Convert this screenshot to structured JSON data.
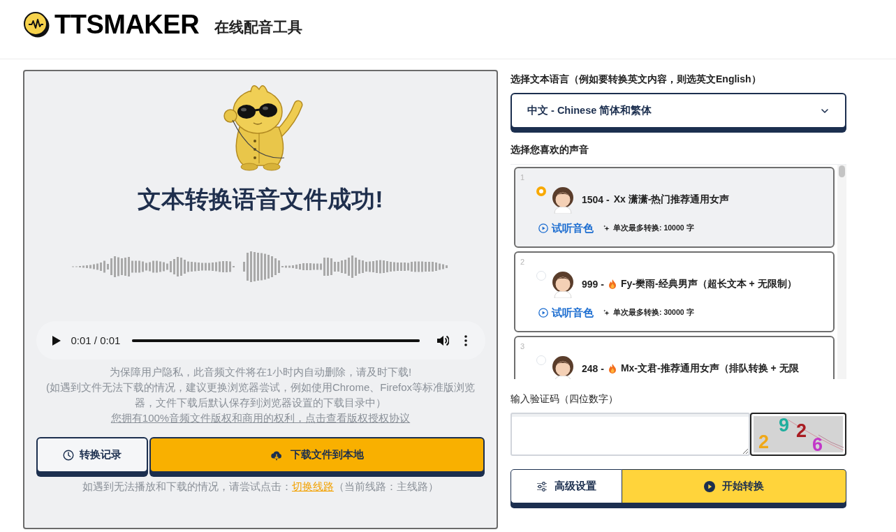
{
  "header": {
    "logo_text": "TTSMAKER",
    "tagline": "在线配音工具"
  },
  "result": {
    "title": "文本转换语音文件成功!",
    "player": {
      "time": "0:01 / 0:01",
      "level": 1
    },
    "notice_lines": [
      "为保障用户隐私，此音频文件将在1小时内自动删除，请及时下载!",
      "(如遇到文件无法下载的情况，建议更换浏览器尝试，例如使用Chrome、Firefox等标准版浏览器，文件下载后默认保存到浏览器设置的下载目录中）"
    ],
    "license_link": "您拥有100%音频文件版权和商用的权利，点击查看版权授权协议",
    "buttons": [
      {
        "kind": "history",
        "label": "转换记录"
      },
      {
        "kind": "download",
        "label": "下载文件到本地"
      }
    ],
    "route_note": {
      "text": "如遇到无法播放和下载的情况，请尝试点击：",
      "link": "切换线路",
      "suffix": "（当前线路：主线路）"
    }
  },
  "language": {
    "label": "选择文本语言（例如要转换英文内容，则选英文English）",
    "value": "中文 - Chinese 简体和繁体"
  },
  "voices": {
    "label": "选择您喜欢的声音",
    "items": [
      {
        "index": "1",
        "selected": true,
        "code": "1504 -",
        "hot": false,
        "name": "Xx 潇潇-热门推荐通用女声",
        "preview": "试听音色",
        "limit": "单次最多转换: 10000 字"
      },
      {
        "index": "2",
        "selected": false,
        "code": "999 -",
        "hot": true,
        "name": "Fy-樊雨-经典男声（超长文本 + 无限制）",
        "preview": "试听音色",
        "limit": "单次最多转换: 30000 字"
      },
      {
        "index": "3",
        "selected": false,
        "code": "248 -",
        "hot": true,
        "name": "Mx-文君-推荐通用女声（排队转换 + 无限"
      }
    ]
  },
  "captcha": {
    "label": "输入验证码（四位数字）",
    "chars": [
      {
        "text": "2",
        "color": "#f0a818"
      },
      {
        "text": "9",
        "color": "#1fae9e"
      },
      {
        "text": "2",
        "color": "#a81c22"
      },
      {
        "text": "6",
        "color": "#c238c8"
      }
    ]
  },
  "actions": [
    {
      "kind": "settings",
      "label": "高级设置"
    },
    {
      "kind": "start",
      "label": "开始转换"
    }
  ]
}
